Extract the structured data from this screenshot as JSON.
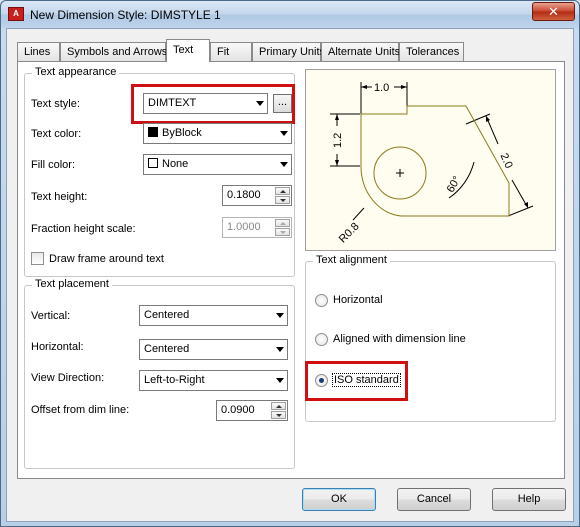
{
  "window": {
    "title": "New Dimension Style: DIMSTYLE 1",
    "app_icon_text": "A",
    "close_symbol": "✕"
  },
  "tabs": [
    {
      "label": "Lines",
      "active": false
    },
    {
      "label": "Symbols and Arrows",
      "active": false
    },
    {
      "label": "Text",
      "active": true
    },
    {
      "label": "Fit",
      "active": false
    },
    {
      "label": "Primary Units",
      "active": false
    },
    {
      "label": "Alternate Units",
      "active": false
    },
    {
      "label": "Tolerances",
      "active": false
    }
  ],
  "text_appearance": {
    "title": "Text appearance",
    "text_style_label": "Text style:",
    "text_style_value": "DIMTEXT",
    "browse_label": "...",
    "text_color_label": "Text color:",
    "text_color_value": "ByBlock",
    "fill_color_label": "Fill color:",
    "fill_color_value": "None",
    "text_height_label": "Text height:",
    "text_height_value": "0.1800",
    "fraction_scale_label": "Fraction height scale:",
    "fraction_scale_value": "1.0000",
    "draw_frame_label": "Draw frame around text",
    "draw_frame_checked": false
  },
  "text_placement": {
    "title": "Text placement",
    "vertical_label": "Vertical:",
    "vertical_value": "Centered",
    "horizontal_label": "Horizontal:",
    "horizontal_value": "Centered",
    "view_direction_label": "View Direction:",
    "view_direction_value": "Left-to-Right",
    "offset_label": "Offset from dim line:",
    "offset_value": "0.0900"
  },
  "preview": {
    "dim_top": "1.0",
    "dim_left": "1.2",
    "dim_right": "2.0",
    "dim_angle": "60°",
    "dim_radius": "R0.8"
  },
  "text_alignment": {
    "title": "Text alignment",
    "options": [
      {
        "label": "Horizontal",
        "checked": false
      },
      {
        "label": "Aligned with dimension line",
        "checked": false
      },
      {
        "label": "ISO standard",
        "checked": true
      }
    ]
  },
  "buttons": {
    "ok": "OK",
    "cancel": "Cancel",
    "help": "Help"
  },
  "colors": {
    "highlight": "#d01010",
    "preview_geometry": "#8a7a1a"
  }
}
